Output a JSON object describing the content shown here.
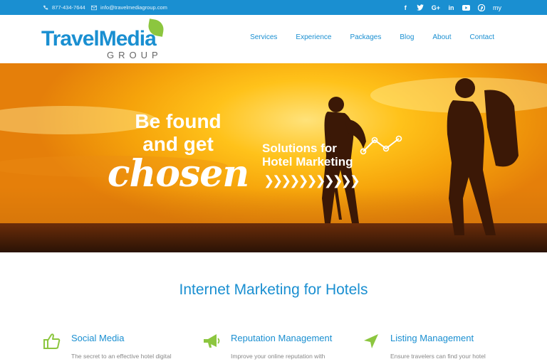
{
  "topbar": {
    "phone": "877-434-7644",
    "email": "info@travelmediagroup.com",
    "social": [
      "f",
      "t",
      "G+",
      "in",
      "yt",
      "p",
      "my"
    ]
  },
  "logo": {
    "word_travel": "Travel",
    "word_media": "Media",
    "word_group": "GROUP"
  },
  "nav": {
    "items": [
      "Services",
      "Experience",
      "Packages",
      "Blog",
      "About",
      "Contact"
    ]
  },
  "hero": {
    "line1": "Be found",
    "line2": "and get",
    "line3": "chosen",
    "sol1": "Solutions for",
    "sol2": "Hotel Marketing",
    "chevrons": "❯❯❯❯❯❯❯❯❯❯❯"
  },
  "main": {
    "title": "Internet Marketing for Hotels",
    "features": [
      {
        "title": "Social Media",
        "text": "The secret to an effective hotel digital",
        "icon": "thumbs-up-icon"
      },
      {
        "title": "Reputation Management",
        "text": "Improve your online reputation with",
        "icon": "megaphone-icon"
      },
      {
        "title": "Listing Management",
        "text": "Ensure travelers can find your hotel",
        "icon": "location-arrow-icon"
      }
    ]
  },
  "colors": {
    "brand": "#1a8fd1",
    "accent": "#8cc63f"
  }
}
